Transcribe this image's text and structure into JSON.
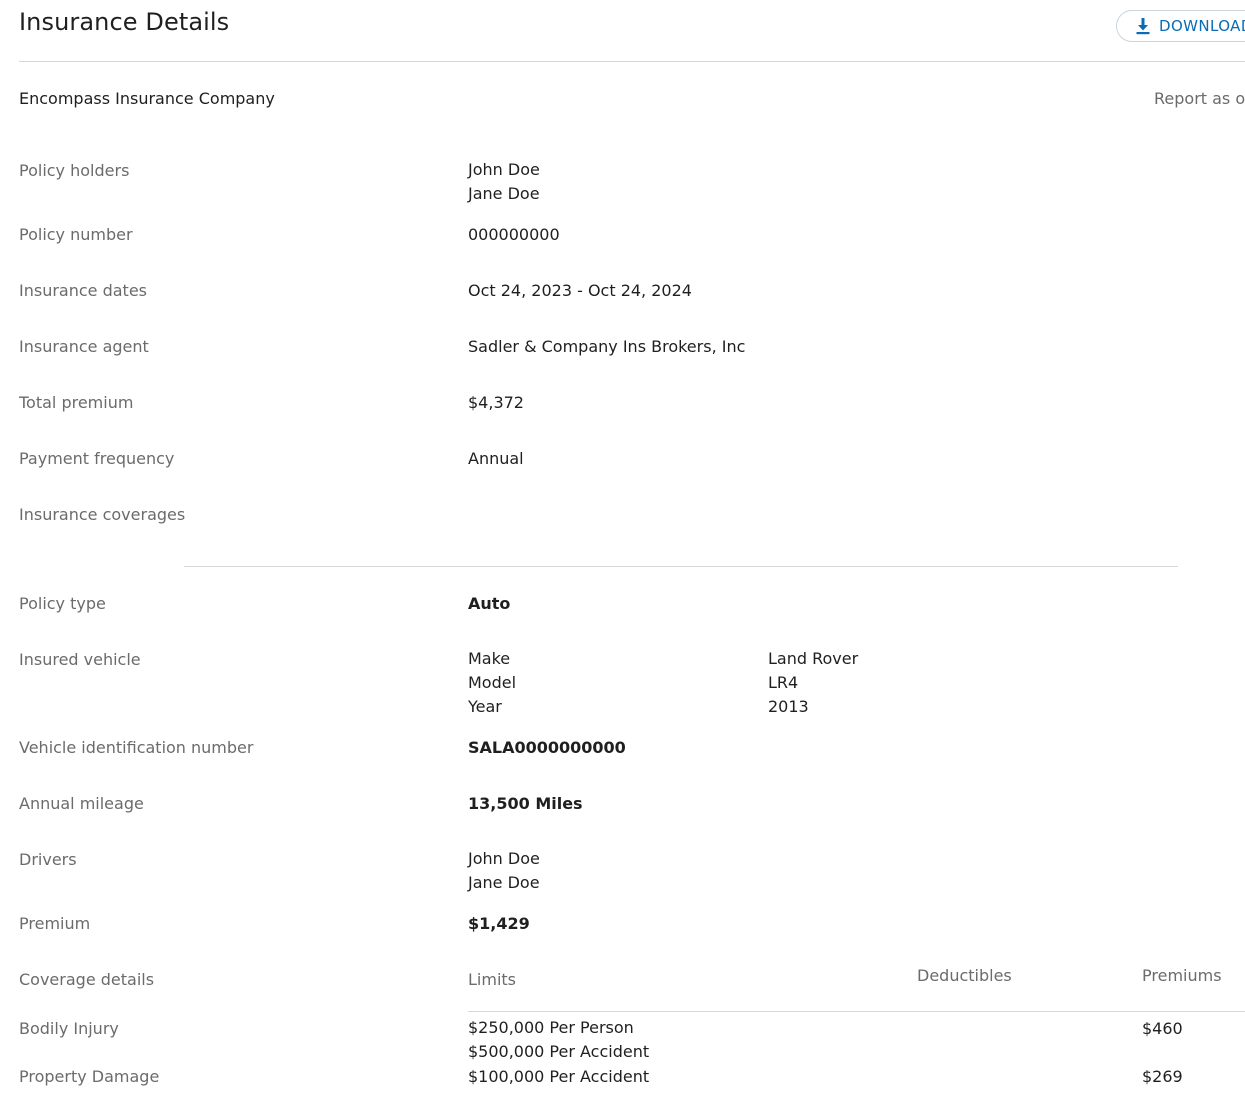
{
  "header": {
    "title": "Insurance Details",
    "download_label": "DOWNLOAD"
  },
  "company": {
    "name": "Encompass Insurance Company",
    "report_as_of": "Report as of"
  },
  "policy": {
    "holders_label": "Policy holders",
    "holders": [
      "John Doe",
      "Jane Doe"
    ],
    "number_label": "Policy number",
    "number": "000000000",
    "dates_label": "Insurance dates",
    "dates": "Oct 24, 2023 - Oct 24, 2024",
    "agent_label": "Insurance agent",
    "agent": "Sadler & Company Ins Brokers, Inc",
    "total_premium_label": "Total premium",
    "total_premium": "$4,372",
    "payment_frequency_label": "Payment frequency",
    "payment_frequency": "Annual",
    "coverages_label": "Insurance coverages"
  },
  "coverage": {
    "policy_type_label": "Policy type",
    "policy_type": "Auto",
    "vehicle_label": "Insured vehicle",
    "vehicle": {
      "make_label": "Make",
      "make": "Land Rover",
      "model_label": "Model",
      "model": "LR4",
      "year_label": "Year",
      "year": "2013"
    },
    "vin_label": "Vehicle identification number",
    "vin": "SALA0000000000",
    "mileage_label": "Annual mileage",
    "mileage": "13,500 Miles",
    "drivers_label": "Drivers",
    "drivers": [
      "John Doe",
      "Jane Doe"
    ],
    "premium_label": "Premium",
    "premium": "$1,429",
    "details": {
      "label": "Coverage details",
      "col_limits": "Limits",
      "col_deductibles": "Deductibles",
      "col_premiums": "Premiums",
      "rows": [
        {
          "name": "Bodily Injury",
          "limits": [
            "$250,000 Per Person",
            "$500,000 Per Accident"
          ],
          "premium": "$460"
        },
        {
          "name": "Property Damage",
          "limits": [
            "$100,000 Per Accident"
          ],
          "premium": "$269"
        }
      ]
    }
  }
}
